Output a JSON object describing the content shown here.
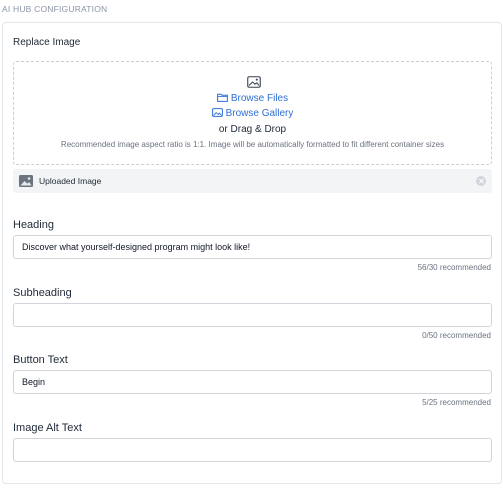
{
  "section_title": "AI HUB CONFIGURATION",
  "replace_image": {
    "title": "Replace Image",
    "browse_files": "Browse Files",
    "browse_gallery": "Browse Gallery",
    "drag_drop": "or Drag & Drop",
    "hint": "Recommended image aspect ratio is 1:1. Image will be automatically formatted to fit different container sizes",
    "uploaded_label": "Uploaded Image",
    "link_color": "#2f6fd6"
  },
  "fields": {
    "heading": {
      "label": "Heading",
      "value": "Discover what yourself-designed program might look like!",
      "counter": "56/30 recommended"
    },
    "subheading": {
      "label": "Subheading",
      "value": "",
      "counter": "0/50 recommended"
    },
    "button_text": {
      "label": "Button Text",
      "value": "Begin",
      "counter": "5/25 recommended"
    },
    "image_alt_text": {
      "label": "Image Alt Text",
      "value": ""
    }
  }
}
